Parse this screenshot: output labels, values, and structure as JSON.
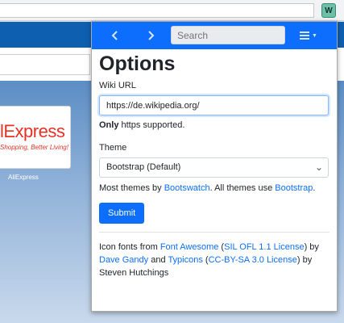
{
  "browser": {
    "extension_icon_label": "W"
  },
  "background": {
    "tile_logo": "lExpress",
    "tile_tagline": "Shopping, Better Living!",
    "tile_caption": "AliExpress"
  },
  "popup": {
    "navbar": {
      "back_icon": "chevron-left-icon",
      "forward_icon": "chevron-right-icon",
      "search_placeholder": "Search",
      "menu_icon": "hamburger-menu-icon"
    },
    "title": "Options",
    "wiki_url": {
      "label": "Wiki URL",
      "value": "https://de.wikipedia.org/",
      "help_bold": "Only",
      "help_rest": " https supported."
    },
    "theme": {
      "label": "Theme",
      "selected": "Bootstrap (Default)",
      "note_before": "Most themes by ",
      "note_link1": "Bootswatch",
      "note_middle": ". All themes use ",
      "note_link2": "Bootstrap",
      "note_after": "."
    },
    "submit_label": "Submit",
    "credits": {
      "t1": "Icon fonts from ",
      "l1": "Font Awesome",
      "t2": " (",
      "l2": "SIL OFL 1.1 License",
      "t3": ") by ",
      "l3": "Dave Gandy",
      "t4": " and ",
      "l4": "Typicons",
      "t5": " (",
      "l5": "CC-BY-SA 3.0 License",
      "t6": ") by Steven Hutchings"
    }
  },
  "colors": {
    "accent": "#0d6efd",
    "link": "#0d6efd"
  }
}
